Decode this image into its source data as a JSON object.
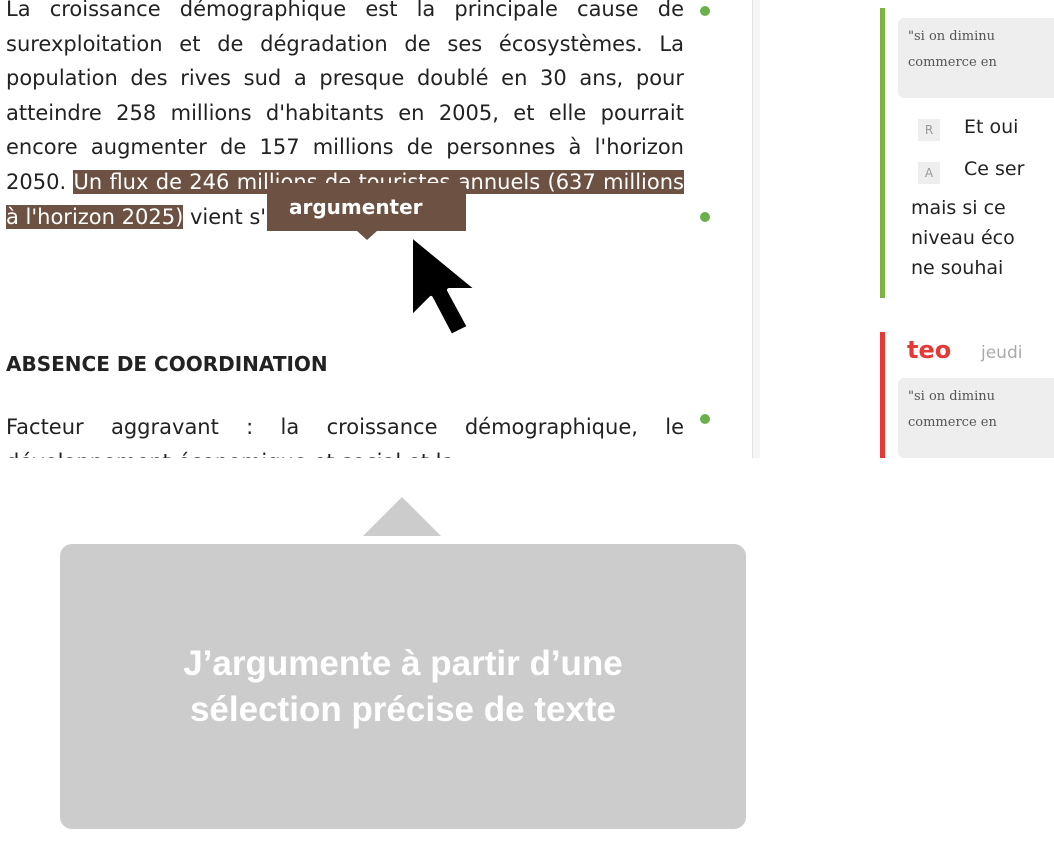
{
  "article": {
    "paragraph1_plain": "La croissance démographique est la principale cause de surexploitation et de dégradation de ses écosystèmes. La population des rives sud a presque doublé en 30 ans, pour atteindre 258 millions d'habitants en 2005, et elle pourrait encore augmenter de 157 millions de personnes à l'horizon 2050.",
    "paragraph1_selected": "Un flux de 246 millions de touristes annuels (637 millions à l'horizon 2025)",
    "paragraph1_tail": " vient s'y ajouter.",
    "heading": "ABSENCE DE COORDINATION",
    "paragraph2": "Facteur aggravant : la croissance démographique, le développement économique et social et la ..."
  },
  "tooltip": {
    "label": "argumenter"
  },
  "comments": {
    "thread1": {
      "quote_line1": "\"si on diminu",
      "quote_line2": "commerce en",
      "reply_tag": "R",
      "reply_text": "Et oui",
      "answer_tag": "A",
      "answer_line1": "Ce ser",
      "answer_line2": "mais si ce",
      "answer_line3": "niveau éco",
      "answer_line4": "ne souhai"
    },
    "thread2": {
      "author": "teo",
      "date": "jeudi",
      "quote_line1": "\"si on diminu",
      "quote_line2": "commerce en"
    }
  },
  "callout": {
    "line1": "J’argumente à partir d’une",
    "line2": "sélection précise de texte"
  },
  "colors": {
    "selection": "#6d5243",
    "dot_green": "#6ab04c",
    "thread_green": "#7cb342",
    "thread_red": "#e53935",
    "callout_bg": "#cccccc"
  }
}
